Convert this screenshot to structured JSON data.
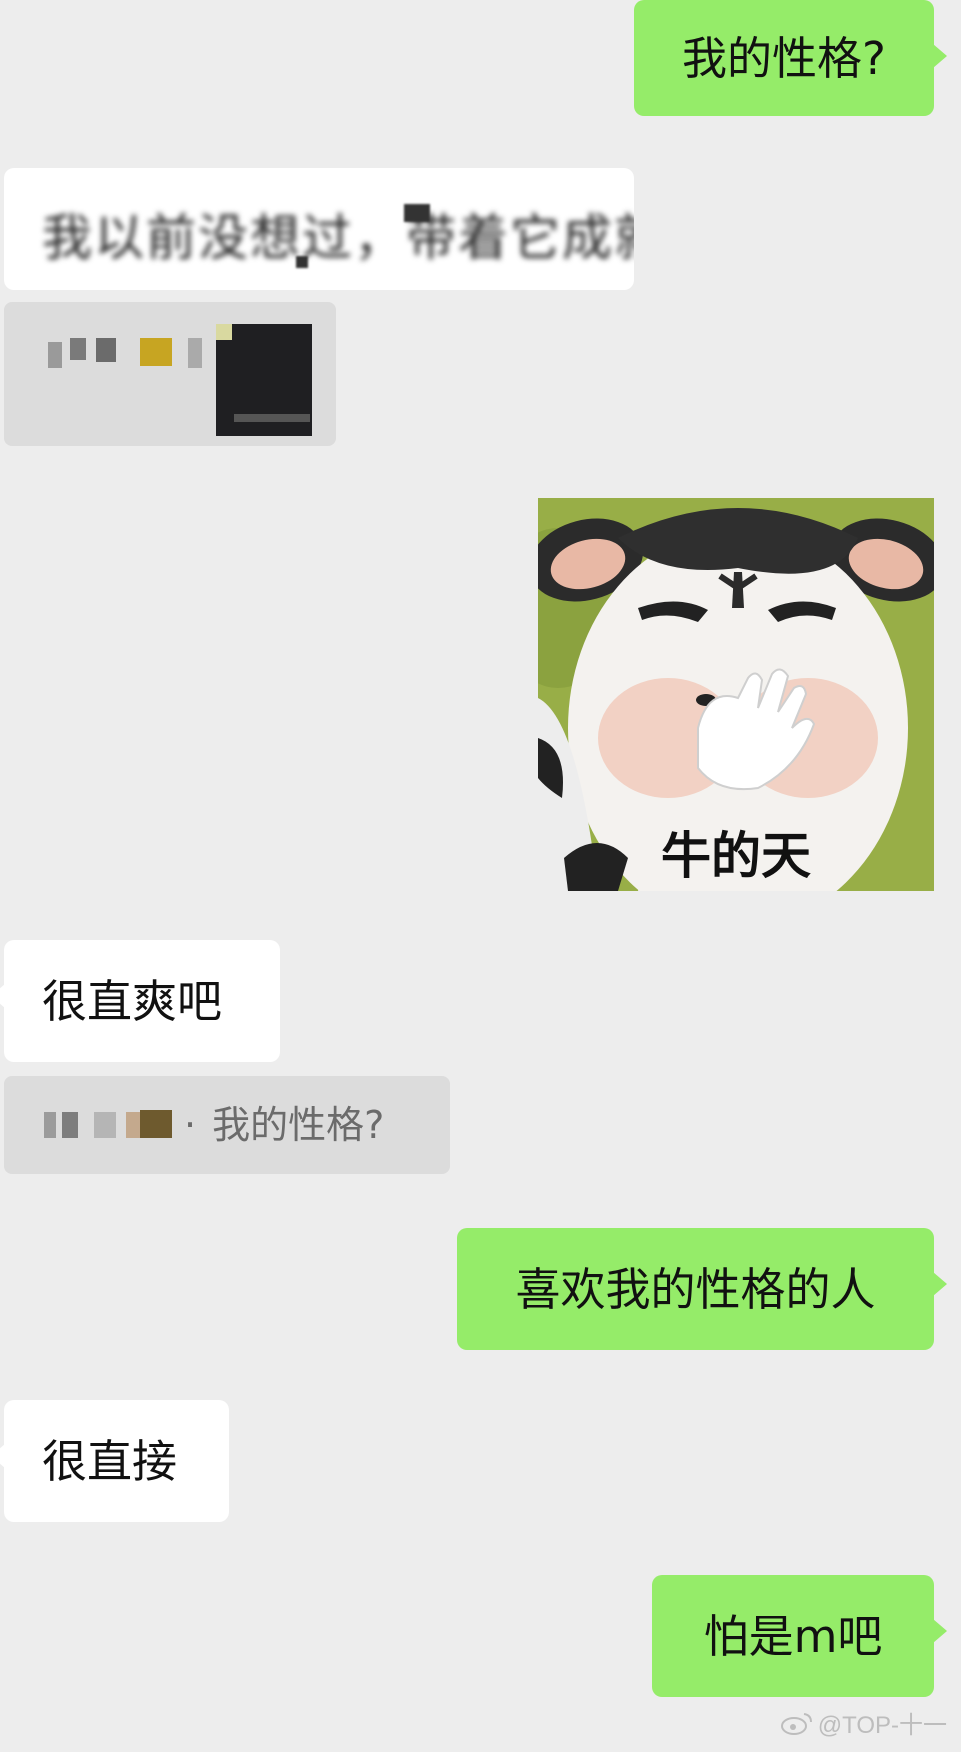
{
  "messages": {
    "m1": "我的性格?",
    "m2_blurred": "我以前没想过，带着它成就感",
    "sticker_caption": "牛的天",
    "m4": "很直爽吧",
    "quote_text": "我的性格?",
    "m5": "喜欢我的性格的人",
    "m6": "很直接",
    "m7": "怕是m吧"
  },
  "watermark": "@TOP-十一",
  "colors": {
    "background": "#ededed",
    "bubble_right": "#95ec69",
    "bubble_left": "#ffffff",
    "quote_bg": "#dcdcdc"
  }
}
